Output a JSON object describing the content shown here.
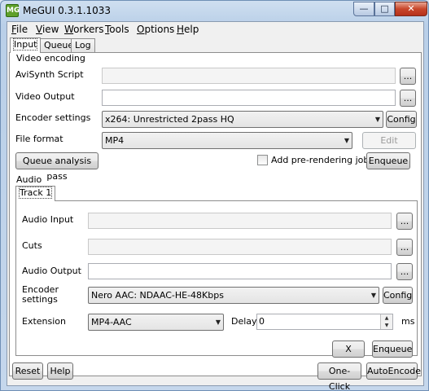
{
  "window": {
    "title": "MeGUI 0.3.1.1033",
    "app_icon_text": "MG"
  },
  "menu": [
    {
      "label_u": "F",
      "label_rest": "ile"
    },
    {
      "label_u": "V",
      "label_rest": "iew"
    },
    {
      "label_u": "W",
      "label_rest": "orkers"
    },
    {
      "label_u": "T",
      "label_rest": "ools"
    },
    {
      "label_u": "O",
      "label_rest": "ptions"
    },
    {
      "label_u": "H",
      "label_rest": "elp"
    }
  ],
  "tabs": [
    "Input",
    "Queue",
    "Log"
  ],
  "video": {
    "section": "Video encoding",
    "avisynth_label": "AviSynth Script",
    "avisynth_value": "",
    "output_label": "Video Output",
    "output_value": "",
    "encoder_label": "Encoder settings",
    "encoder_value": "x264: Unrestricted 2pass HQ",
    "config_label": "Config",
    "format_label": "File format",
    "format_value": "MP4",
    "edit_zones_label": "Edit zones...",
    "queue_analysis_label": "Queue analysis pass",
    "prerender_label": "Add pre-rendering job",
    "enqueue_label": "Enqueue",
    "browse_label": "..."
  },
  "audio": {
    "section": "Audio",
    "track_tab": "Track 1",
    "input_label": "Audio Input",
    "cuts_label": "Cuts",
    "output_label": "Audio Output",
    "encoder_label_1": "Encoder",
    "encoder_label_2": "settings",
    "encoder_value": "Nero AAC: NDAAC-HE-48Kbps",
    "config_label": "Config",
    "extension_label": "Extension",
    "extension_value": "MP4-AAC",
    "delay_label": "Delay",
    "delay_value": "0",
    "ms_label": "ms",
    "x_label": "X",
    "enqueue_label": "Enqueue",
    "browse_label": "..."
  },
  "footer": {
    "reset": "Reset",
    "help": "Help",
    "one_click": "One-Click",
    "auto_encode": "AutoEncode"
  }
}
